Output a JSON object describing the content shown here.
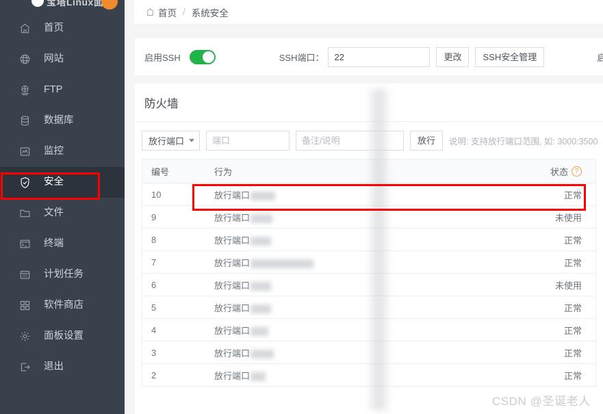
{
  "sidebar": {
    "logo_text": "宝塔Linux面板",
    "logo_badge": "",
    "items": [
      {
        "label": "首页",
        "icon": "home-icon",
        "name": "sidebar-item-home"
      },
      {
        "label": "网站",
        "icon": "globe-icon",
        "name": "sidebar-item-website"
      },
      {
        "label": "FTP",
        "icon": "ftp-icon",
        "name": "sidebar-item-ftp"
      },
      {
        "label": "数据库",
        "icon": "database-icon",
        "name": "sidebar-item-database"
      },
      {
        "label": "监控",
        "icon": "monitor-icon",
        "name": "sidebar-item-monitor"
      },
      {
        "label": "安全",
        "icon": "shield-icon",
        "name": "sidebar-item-security",
        "active": true
      },
      {
        "label": "文件",
        "icon": "folder-icon",
        "name": "sidebar-item-files"
      },
      {
        "label": "终端",
        "icon": "terminal-icon",
        "name": "sidebar-item-terminal"
      },
      {
        "label": "计划任务",
        "icon": "calendar-icon",
        "name": "sidebar-item-crontab"
      },
      {
        "label": "软件商店",
        "icon": "apps-icon",
        "name": "sidebar-item-appstore"
      },
      {
        "label": "面板设置",
        "icon": "gear-icon",
        "name": "sidebar-item-settings"
      },
      {
        "label": "退出",
        "icon": "logout-icon",
        "name": "sidebar-item-logout"
      }
    ]
  },
  "breadcrumb": {
    "home": "首页",
    "separator": "/",
    "current": "系统安全"
  },
  "ssh_panel": {
    "ssh_switch_label": "启用SSH",
    "ssh_switch_state": "on",
    "port_label": "SSH端口：",
    "port_value": "22",
    "port_placeholder": "",
    "change_button": "更改",
    "security_button": "SSH安全管理",
    "ping_switch_label": "启用禁ping",
    "ping_switch_state": "off"
  },
  "firewall": {
    "title": "防火墙",
    "rule_type_selected": "放行端口",
    "port_placeholder": "端口",
    "note_placeholder": "备注/说明",
    "submit_button": "放行",
    "hint": "说明: 支持放行端口范围, 如: 3000:3500",
    "columns": {
      "id": "编号",
      "action": "行为",
      "status": "状态",
      "status_help": "?"
    },
    "rows": [
      {
        "id": "10",
        "action": "放行端口",
        "redact_w": 36,
        "status": "正常",
        "highlighted": true
      },
      {
        "id": "9",
        "action": "放行端口",
        "redact_w": 32,
        "status": "未使用"
      },
      {
        "id": "8",
        "action": "放行端口",
        "redact_w": 30,
        "status": "正常"
      },
      {
        "id": "7",
        "action": "放行端口",
        "redact_w": 92,
        "status": "正常"
      },
      {
        "id": "6",
        "action": "放行端口",
        "redact_w": 30,
        "status": "未使用"
      },
      {
        "id": "5",
        "action": "放行端口",
        "redact_w": 30,
        "status": "正常"
      },
      {
        "id": "4",
        "action": "放行端口",
        "redact_w": 26,
        "status": "正常"
      },
      {
        "id": "3",
        "action": "放行端口",
        "redact_w": 34,
        "status": "正常"
      },
      {
        "id": "2",
        "action": "放行端口",
        "redact_w": 22,
        "status": "正常"
      }
    ]
  },
  "watermark": "CSDN @圣诞老人",
  "colors": {
    "sidebar_bg": "#39414d",
    "sidebar_active_bg": "#2c333d",
    "accent_green": "#22b34b",
    "annotation_red": "#fe0000",
    "badge_orange": "#f1892d",
    "help_orange": "#f19c3c"
  }
}
